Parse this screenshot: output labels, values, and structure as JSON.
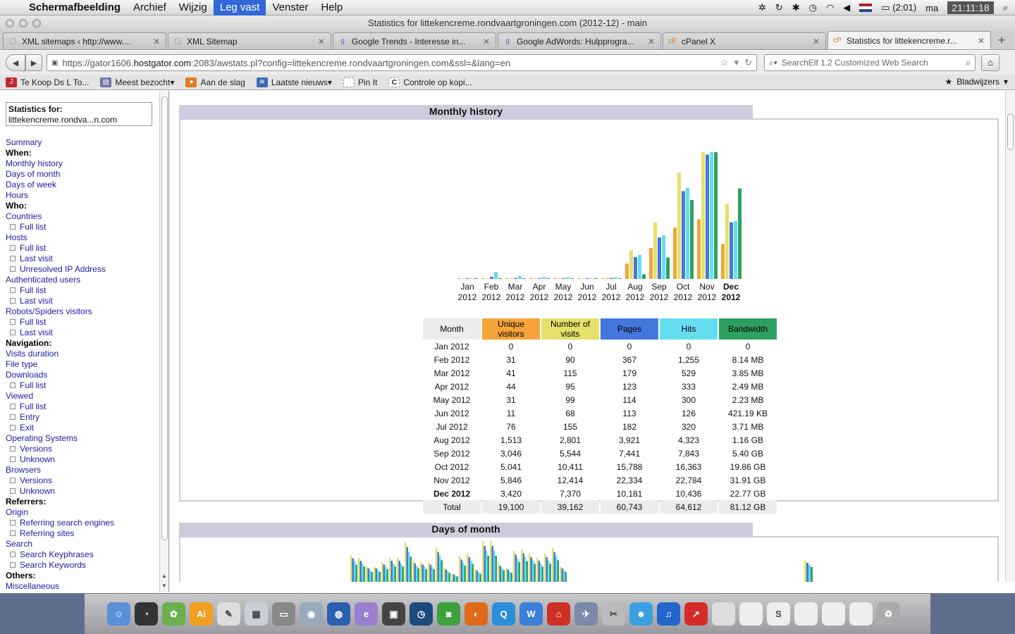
{
  "menubar": {
    "app": "Schermafbeelding",
    "items": [
      "Archief",
      "Wijzig",
      "Leg vast",
      "Venster",
      "Help"
    ],
    "active_item": "Leg vast",
    "battery": "(2:01)",
    "day": "ma",
    "time": "21:11:18"
  },
  "window": {
    "title": "Statistics for littekencreme.rondvaartgroningen.com (2012-12) - main"
  },
  "tabs": [
    {
      "title": "XML sitemaps ‹ http://www....",
      "icon": "page-icon"
    },
    {
      "title": "XML Sitemap",
      "icon": "page-icon"
    },
    {
      "title": "Google Trends - Interesse in...",
      "icon": "google-icon"
    },
    {
      "title": "Google AdWords: Hulpprogra...",
      "icon": "google-icon"
    },
    {
      "title": "cPanel X",
      "icon": "cpanel-icon"
    },
    {
      "title": "Statistics for littekencreme.r...",
      "icon": "cpanel-icon",
      "active": true
    }
  ],
  "navbar": {
    "url_prefix": "https://gator1606.",
    "url_domain": "hostgator.com",
    "url_rest": ":2083/awstats.pl?config=littekencreme.rondvaartgroningen.com&ssl=&lang=en",
    "search_placeholder": "SearchElf 1.2 Customized Web Search"
  },
  "bookmarks": {
    "items": [
      {
        "label": "Te Koop Ds L To...",
        "color": "#c0282d",
        "glyph": "J"
      },
      {
        "label": "Meest bezocht",
        "color": "#6f73a5",
        "glyph": "▤",
        "dropdown": true
      },
      {
        "label": "Aan de slag",
        "color": "#e37c1e",
        "glyph": "●"
      },
      {
        "label": "Laatste nieuws",
        "color": "#3b6bb5",
        "glyph": "≋",
        "dropdown": true
      },
      {
        "label": "Pin It",
        "color": "#ffffff",
        "glyph": ""
      },
      {
        "label": "Controle op kopi...",
        "color": "#ffffff",
        "glyph": "C"
      }
    ],
    "right_label": "Bladwijzers"
  },
  "sidebar": {
    "stats_label": "Statistics for:",
    "stats_site": "littekencreme.rondva...n.com",
    "menu": [
      {
        "t": "Summary",
        "k": "lk"
      },
      {
        "t": "When:",
        "k": "sec"
      },
      {
        "t": "Monthly history",
        "k": "lk"
      },
      {
        "t": "Days of month",
        "k": "lk"
      },
      {
        "t": "Days of week",
        "k": "lk"
      },
      {
        "t": "Hours",
        "k": "lk"
      },
      {
        "t": "Who:",
        "k": "sec"
      },
      {
        "t": "Countries",
        "k": "lk"
      },
      {
        "t": "Full list",
        "k": "sub"
      },
      {
        "t": "Hosts",
        "k": "lk"
      },
      {
        "t": "Full list",
        "k": "sub"
      },
      {
        "t": "Last visit",
        "k": "sub"
      },
      {
        "t": "Unresolved IP Address",
        "k": "sub"
      },
      {
        "t": "Authenticated users",
        "k": "lk"
      },
      {
        "t": "Full list",
        "k": "sub"
      },
      {
        "t": "Last visit",
        "k": "sub"
      },
      {
        "t": "Robots/Spiders visitors",
        "k": "lk"
      },
      {
        "t": "Full list",
        "k": "sub"
      },
      {
        "t": "Last visit",
        "k": "sub"
      },
      {
        "t": "Navigation:",
        "k": "sec"
      },
      {
        "t": "Visits duration",
        "k": "lk"
      },
      {
        "t": "File type",
        "k": "lk"
      },
      {
        "t": "Downloads",
        "k": "lk"
      },
      {
        "t": "Full list",
        "k": "sub"
      },
      {
        "t": "Viewed",
        "k": "lk"
      },
      {
        "t": "Full list",
        "k": "sub"
      },
      {
        "t": "Entry",
        "k": "sub"
      },
      {
        "t": "Exit",
        "k": "sub"
      },
      {
        "t": "Operating Systems",
        "k": "lk"
      },
      {
        "t": "Versions",
        "k": "sub"
      },
      {
        "t": "Unknown",
        "k": "sub"
      },
      {
        "t": "Browsers",
        "k": "lk"
      },
      {
        "t": "Versions",
        "k": "sub"
      },
      {
        "t": "Unknown",
        "k": "sub"
      },
      {
        "t": "Referrers:",
        "k": "sec"
      },
      {
        "t": "Origin",
        "k": "lk"
      },
      {
        "t": "Referring search engines",
        "k": "sub"
      },
      {
        "t": "Referring sites",
        "k": "sub"
      },
      {
        "t": "Search",
        "k": "lk"
      },
      {
        "t": "Search Keyphrases",
        "k": "sub"
      },
      {
        "t": "Search Keywords",
        "k": "sub"
      },
      {
        "t": "Others:",
        "k": "sec"
      },
      {
        "t": "Miscellaneous",
        "k": "lk"
      }
    ]
  },
  "monthly": {
    "header": "Monthly history",
    "colors": {
      "unique": "#f4a43a",
      "visits": "#e4e06a",
      "pages": "#4477dd",
      "hits": "#66ddee",
      "bandwidth": "#2ea160"
    },
    "columns": [
      "Month",
      "Unique visitors",
      "Number of visits",
      "Pages",
      "Hits",
      "Bandwidth"
    ],
    "rows": [
      [
        "Jan 2012",
        "0",
        "0",
        "0",
        "0",
        "0"
      ],
      [
        "Feb 2012",
        "31",
        "90",
        "367",
        "1,255",
        "8.14 MB"
      ],
      [
        "Mar 2012",
        "41",
        "115",
        "179",
        "529",
        "3.85 MB"
      ],
      [
        "Apr 2012",
        "44",
        "95",
        "123",
        "333",
        "2.49 MB"
      ],
      [
        "May 2012",
        "31",
        "99",
        "114",
        "300",
        "2.23 MB"
      ],
      [
        "Jun 2012",
        "11",
        "68",
        "113",
        "126",
        "421.19 KB"
      ],
      [
        "Jul 2012",
        "76",
        "155",
        "182",
        "320",
        "3.71 MB"
      ],
      [
        "Aug 2012",
        "1,513",
        "2,801",
        "3,921",
        "4,323",
        "1.16 GB"
      ],
      [
        "Sep 2012",
        "3,046",
        "5,544",
        "7,441",
        "7,843",
        "5.40 GB"
      ],
      [
        "Oct 2012",
        "5,041",
        "10,411",
        "15,788",
        "16,363",
        "19.86 GB"
      ],
      [
        "Nov 2012",
        "5,846",
        "12,414",
        "22,334",
        "22,784",
        "31.91 GB"
      ],
      [
        "Dec 2012",
        "3,420",
        "7,370",
        "10,181",
        "10,436",
        "22.77 GB"
      ]
    ],
    "total": [
      "Total",
      "19,100",
      "39,162",
      "60,743",
      "64,612",
      "81.12 GB"
    ]
  },
  "chart_data": {
    "type": "bar",
    "categories": [
      "Jan 2012",
      "Feb 2012",
      "Mar 2012",
      "Apr 2012",
      "May 2012",
      "Jun 2012",
      "Jul 2012",
      "Aug 2012",
      "Sep 2012",
      "Oct 2012",
      "Nov 2012",
      "Dec 2012"
    ],
    "tick_labels": [
      [
        "Jan",
        "2012"
      ],
      [
        "Feb",
        "2012"
      ],
      [
        "Mar",
        "2012"
      ],
      [
        "Apr",
        "2012"
      ],
      [
        "May",
        "2012"
      ],
      [
        "Jun",
        "2012"
      ],
      [
        "Jul",
        "2012"
      ],
      [
        "Aug",
        "2012"
      ],
      [
        "Sep",
        "2012"
      ],
      [
        "Oct",
        "2012"
      ],
      [
        "Nov",
        "2012"
      ],
      [
        "Dec",
        "2012"
      ]
    ],
    "series": [
      {
        "values": [
          0,
          31,
          41,
          44,
          31,
          11,
          76,
          1513,
          3046,
          5041,
          5846,
          3420
        ],
        "color": "#f4a43a"
      },
      {
        "values": [
          0,
          90,
          115,
          95,
          99,
          68,
          155,
          2801,
          5544,
          10411,
          12414,
          7370
        ],
        "color": "#e4e06a"
      },
      {
        "values": [
          0,
          367,
          179,
          123,
          114,
          113,
          182,
          3921,
          7441,
          15788,
          22334,
          10181
        ],
        "color": "#4477dd"
      },
      {
        "values": [
          0,
          1255,
          529,
          333,
          300,
          126,
          320,
          4323,
          7843,
          16363,
          22784,
          10436
        ],
        "color": "#66ddee"
      },
      {
        "values": [
          0,
          0.00814,
          0.00385,
          0.00249,
          0.00223,
          0.00042,
          0.00371,
          1.16,
          5.4,
          19.86,
          31.91,
          22.77
        ],
        "color": "#2ea160"
      }
    ],
    "current_category": "Dec 2012"
  },
  "days": {
    "header": "Days of month"
  },
  "dock": {
    "apps": [
      {
        "name": "finder-icon",
        "c": "#5b8fd6",
        "g": "☺"
      },
      {
        "name": "dashboard-icon",
        "c": "#333",
        "g": "◔"
      },
      {
        "name": "leaf-icon",
        "c": "#6ab04c",
        "g": "✿"
      },
      {
        "name": "illustrator-icon",
        "c": "#f0a01e",
        "g": "Ai"
      },
      {
        "name": "textedit-icon",
        "c": "#ddd",
        "g": "✎"
      },
      {
        "name": "calendar-icon",
        "c": "#c9cfd8",
        "g": "▦"
      },
      {
        "name": "scanner-icon",
        "c": "#888",
        "g": "▭"
      },
      {
        "name": "preview-icon",
        "c": "#9ab",
        "g": "◉"
      },
      {
        "name": "google-earth-icon",
        "c": "#2a5fb0",
        "g": "◍"
      },
      {
        "name": "e-icon",
        "c": "#9a7ed0",
        "g": "e"
      },
      {
        "name": "media-icon",
        "c": "#444",
        "g": "▣"
      },
      {
        "name": "time-machine-icon",
        "c": "#1b4b7a",
        "g": "◷"
      },
      {
        "name": "facetime-icon",
        "c": "#3da13d",
        "g": "◙"
      },
      {
        "name": "firefox-icon",
        "c": "#e06a1a",
        "g": "◐"
      },
      {
        "name": "q-icon",
        "c": "#2a8fd8",
        "g": "Q"
      },
      {
        "name": "w-icon",
        "c": "#3a7fd8",
        "g": "W"
      },
      {
        "name": "pdf-icon",
        "c": "#cf3025",
        "g": "⌂"
      },
      {
        "name": "photo-icon",
        "c": "#7a8aa8",
        "g": "✈"
      },
      {
        "name": "utility-icon",
        "c": "#bbb",
        "g": "✂"
      },
      {
        "name": "messenger-icon",
        "c": "#3aa0e0",
        "g": "☻"
      },
      {
        "name": "itunes-icon",
        "c": "#2266cc",
        "g": "♫"
      },
      {
        "name": "filezilla-icon",
        "c": "#d62b2b",
        "g": "↗"
      },
      {
        "name": "doc1-icon",
        "c": "#ddd",
        "g": ""
      },
      {
        "name": "doc2-icon",
        "c": "#eee",
        "g": ""
      },
      {
        "name": "doc3-icon",
        "c": "#eee",
        "g": "S"
      },
      {
        "name": "doc4-icon",
        "c": "#eee",
        "g": ""
      },
      {
        "name": "doc5-icon",
        "c": "#eee",
        "g": ""
      },
      {
        "name": "doc6-icon",
        "c": "#eee",
        "g": ""
      },
      {
        "name": "trash-icon",
        "c": "#aaa",
        "g": "♻"
      }
    ]
  }
}
